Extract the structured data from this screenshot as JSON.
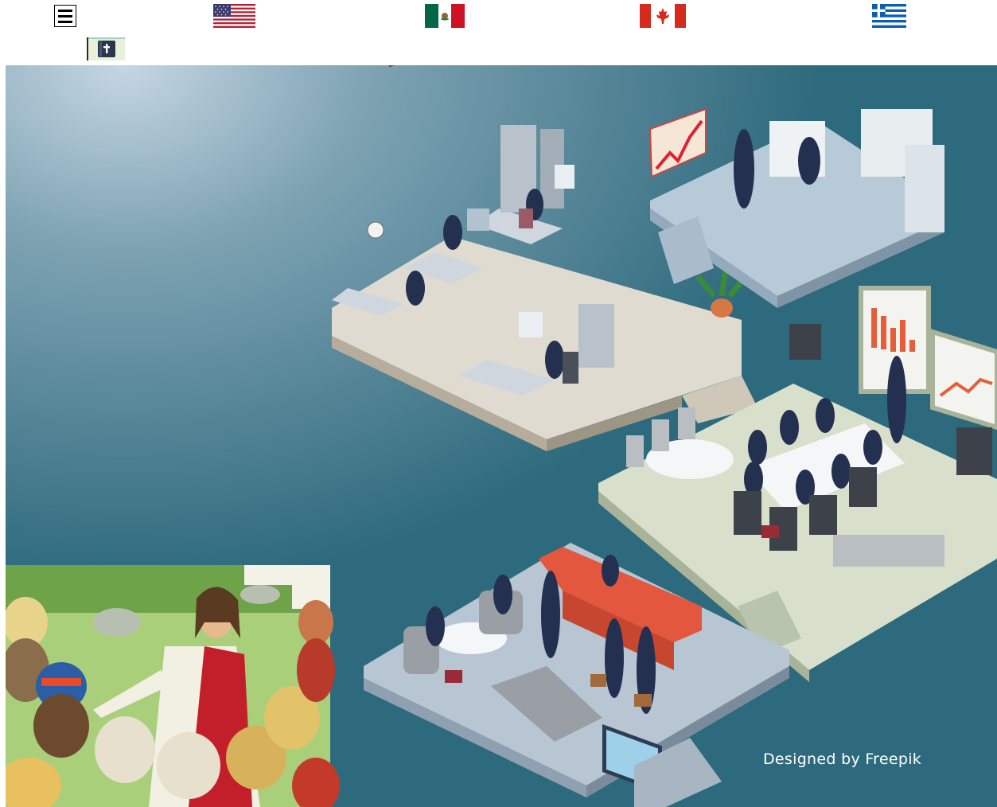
{
  "toolbar": {
    "menu_icon": "hamburger-menu-icon",
    "flags": [
      "usa-flag",
      "mexico-flag",
      "canada-flag",
      "greece-flag"
    ],
    "bible_icon": "bible-icon"
  },
  "illustration": {
    "credit": "Designed by Freepik",
    "background_color": "#2e6a7d",
    "inset_image": "jesus-with-crowd-painting"
  },
  "colors": {
    "usa_red": "#b22234",
    "usa_blue": "#3c3b6e",
    "mexico_green": "#006847",
    "mexico_red": "#ce1126",
    "canada_red": "#d52b1e",
    "greece_blue": "#0d5eaf"
  }
}
